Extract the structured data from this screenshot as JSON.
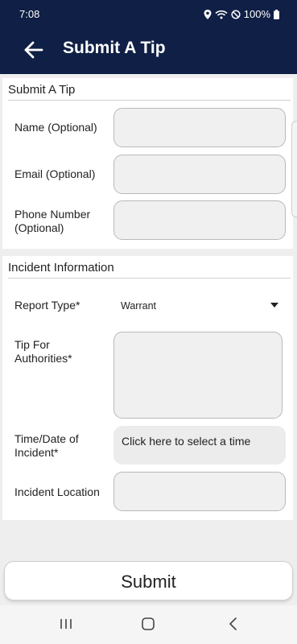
{
  "status_bar": {
    "time": "7:08",
    "battery": "100%",
    "icons": [
      "location-icon",
      "wifi-icon",
      "do-not-disturb-icon",
      "battery-icon"
    ]
  },
  "app_bar": {
    "back_icon": "arrow-left-icon",
    "title": "Submit A Tip"
  },
  "tip_section": {
    "heading": "Submit A Tip",
    "name_label": "Name (Optional)",
    "email_label": "Email (Optional)",
    "phone_label_line1": "Phone Number",
    "phone_label_line2": "(Optional)"
  },
  "incident_section": {
    "heading": "Incident Information",
    "report_type_label": "Report Type*",
    "report_type_value": "Warrant",
    "tip_label_line1": "Tip For",
    "tip_label_line2": "Authorities*",
    "time_label_line1": "Time/Date of",
    "time_label_line2": "Incident*",
    "time_button": "Click here to select a time",
    "location_label": "Incident Location"
  },
  "submit_label": "Submit",
  "nav_bar": {
    "icons": [
      "recent-apps-icon",
      "home-icon",
      "back-icon"
    ]
  },
  "colors": {
    "header_bg": "#0f1f45",
    "field_bg": "#f0f0f0",
    "page_bg": "#eeeeee"
  }
}
